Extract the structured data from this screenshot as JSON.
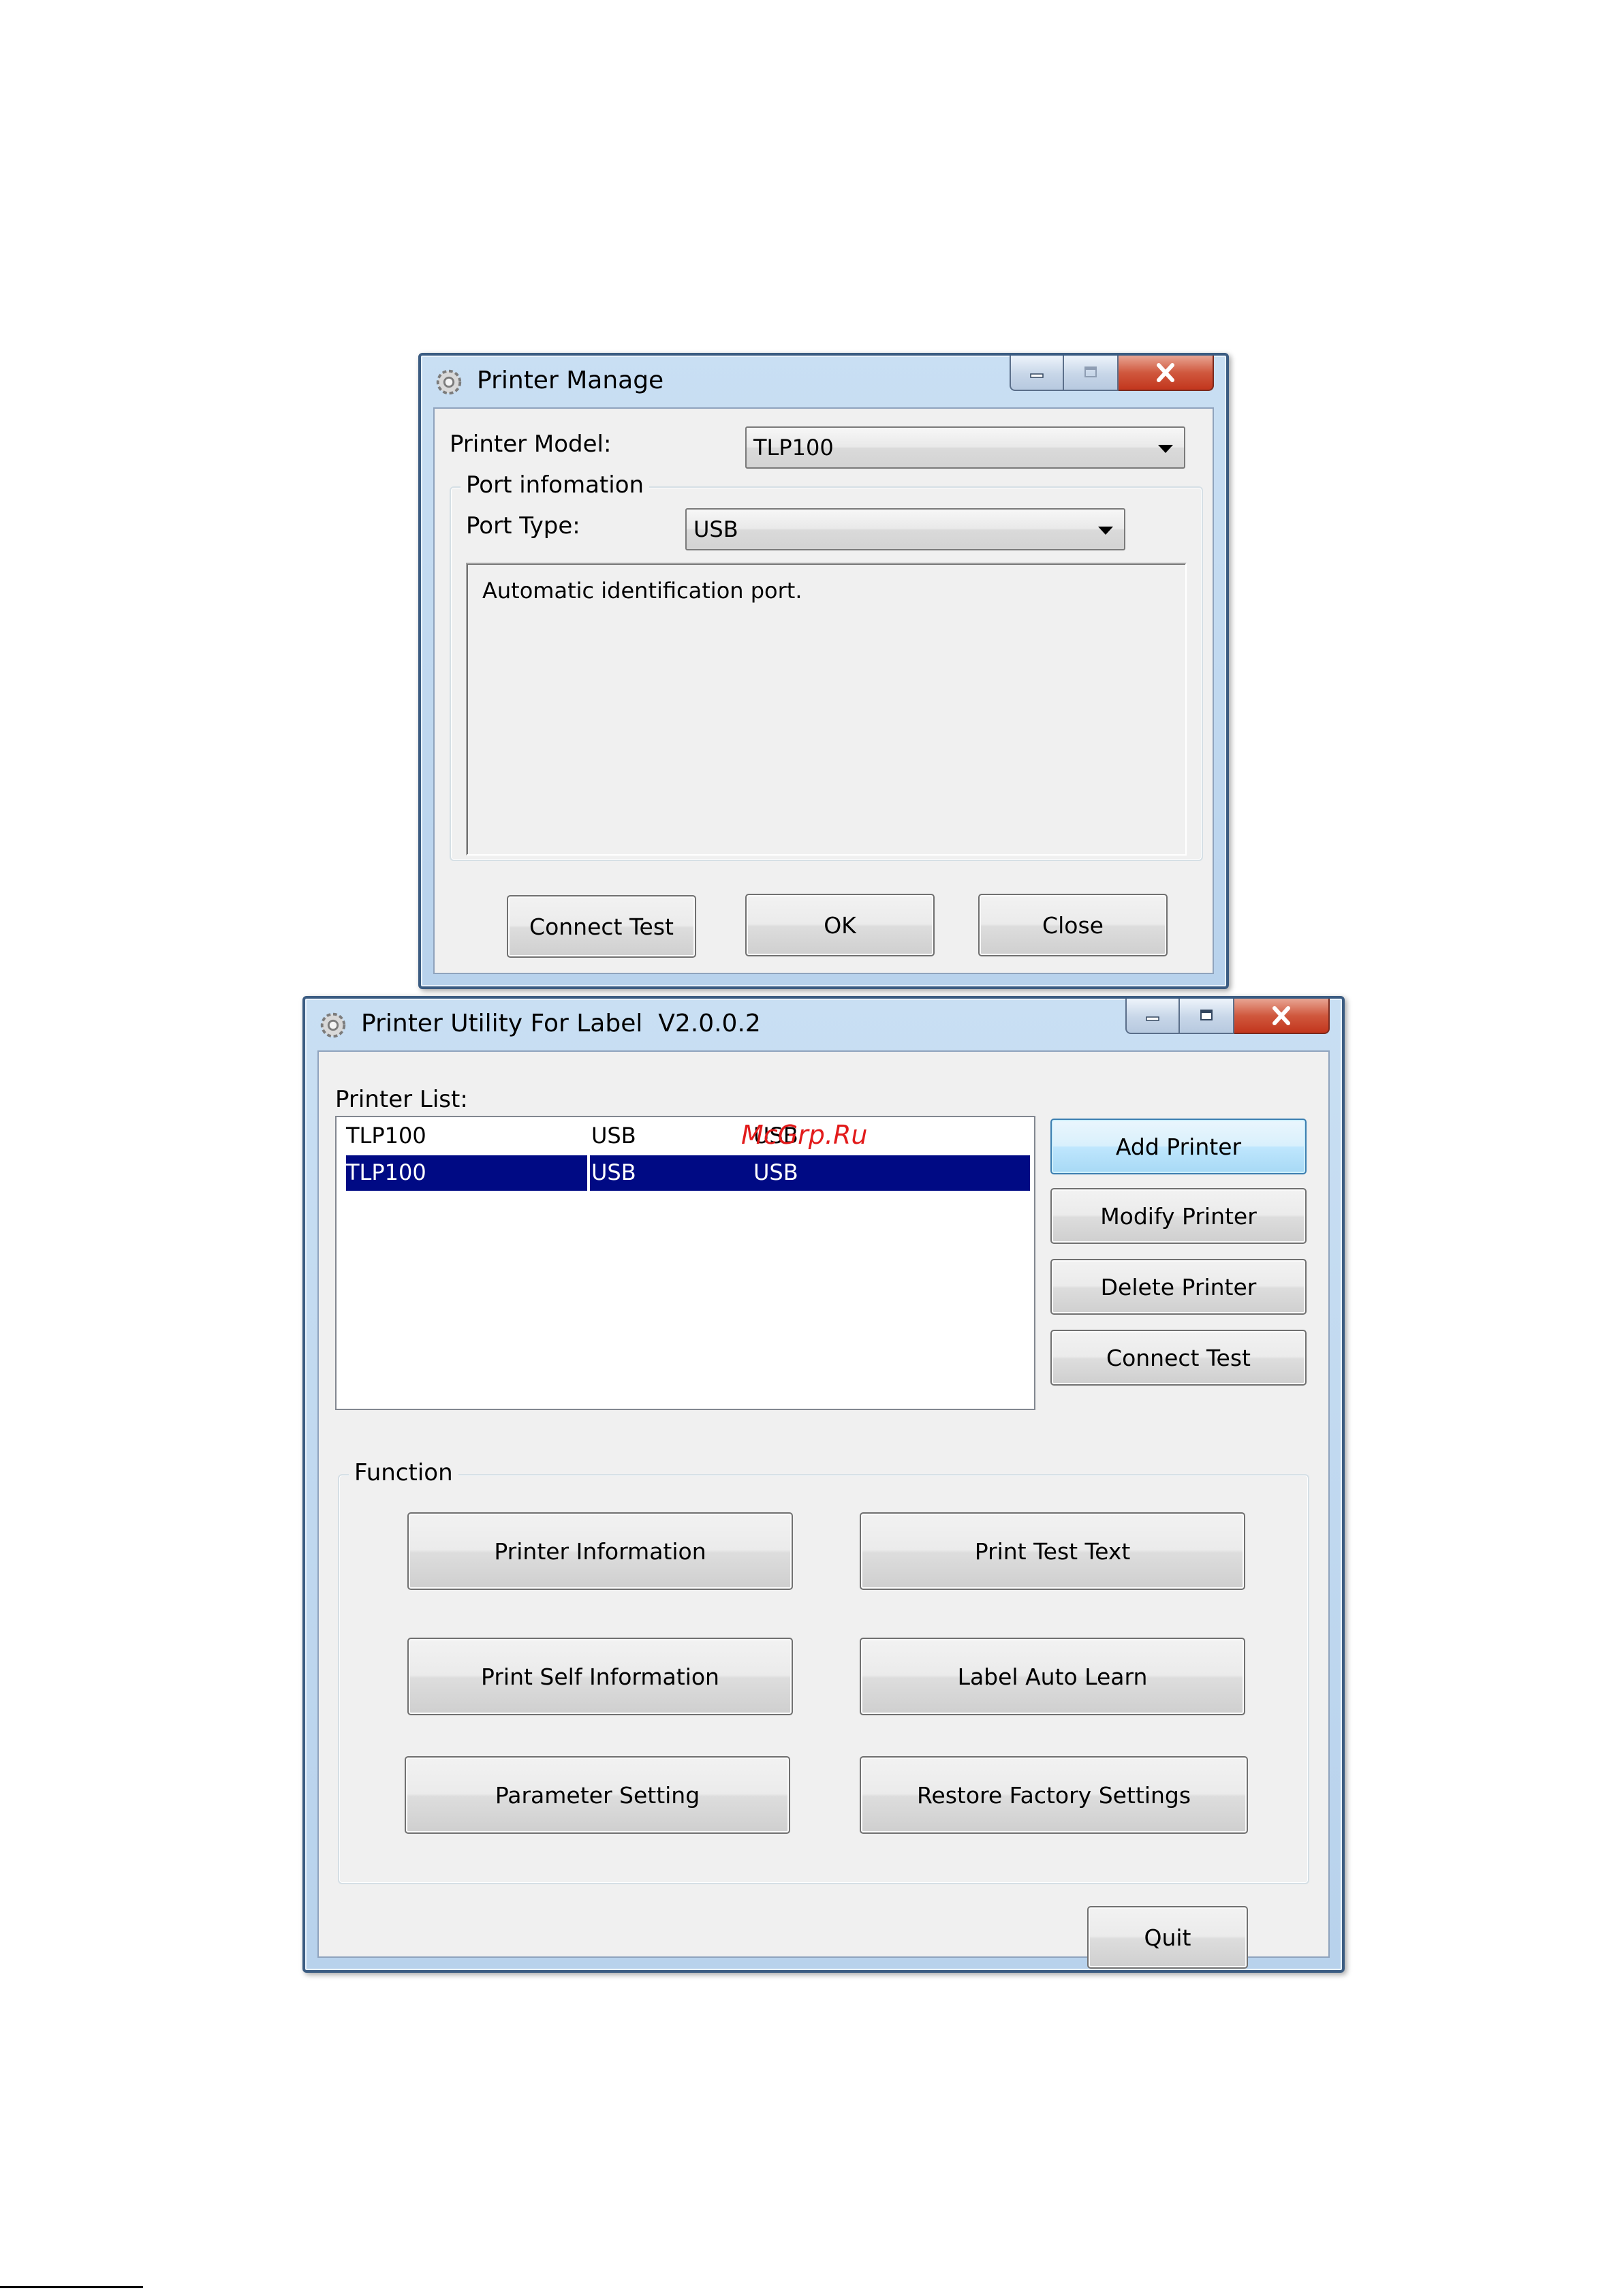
{
  "printer_manage": {
    "title": "Printer Manage",
    "printer_model_label": "Printer Model:",
    "printer_model_value": "TLP100",
    "port_group_label": "Port infomation",
    "port_type_label": "Port Type:",
    "port_type_value": "USB",
    "port_description": "Automatic identification port.",
    "buttons": {
      "connect_test": "Connect Test",
      "ok": "OK",
      "close": "Close"
    }
  },
  "utility": {
    "title": "Printer Utility For Label  V2.0.0.2",
    "printer_list_label": "Printer List:",
    "printers": [
      {
        "model": "TLP100",
        "port": "USB",
        "info": "USB"
      },
      {
        "model": "TLP100",
        "port": "USB",
        "info": "USB"
      }
    ],
    "side_buttons": {
      "add": "Add Printer",
      "modify": "Modify Printer",
      "delete": "Delete Printer",
      "connect_test": "Connect Test"
    },
    "function_label": "Function",
    "function_buttons": {
      "printer_information": "Printer Information",
      "print_test_text": "Print Test Text",
      "print_self_information": "Print Self Information",
      "label_auto_learn": "Label Auto Learn",
      "parameter_setting": "Parameter Setting",
      "restore_factory_settings": "Restore Factory Settings"
    },
    "quit": "Quit"
  },
  "watermark": "McGrp.Ru",
  "colors": {
    "selection": "#000a84",
    "title_frame": "#c9dff3",
    "close_button": "#c2361d"
  }
}
